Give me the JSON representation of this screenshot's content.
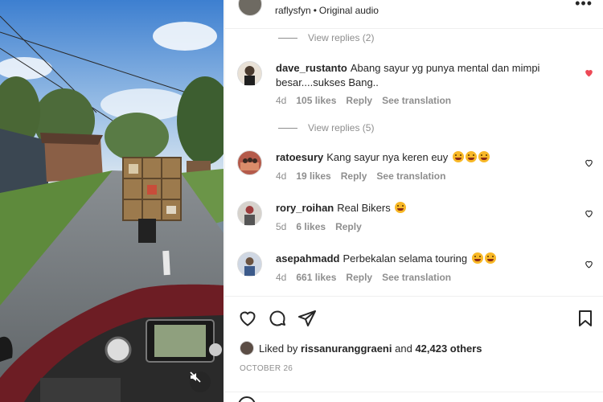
{
  "header": {
    "username": "raflysfyn",
    "separator": "•",
    "audio": "Original audio",
    "more_icon": "more-horizontal-icon"
  },
  "replies": [
    {
      "label": "View replies (2)"
    },
    {
      "label": "View replies (5)"
    }
  ],
  "comments": [
    {
      "username": "dave_rustanto",
      "text": "Abang sayur yg punya mental dan mimpi besar....sukses Bang..",
      "age": "4d",
      "likes": "105 likes",
      "reply": "Reply",
      "translate": "See translation",
      "liked": true
    },
    {
      "username": "ratoesury",
      "text": "Kang sayur nya keren euy",
      "age": "4d",
      "likes": "19 likes",
      "reply": "Reply",
      "translate": "See translation",
      "liked": false
    },
    {
      "username": "rory_roihan",
      "text": "Real Bikers",
      "age": "5d",
      "likes": "6 likes",
      "reply": "Reply",
      "translate": "",
      "liked": false
    },
    {
      "username": "asepahmadd",
      "text": "Perbekalan selama touring",
      "age": "4d",
      "likes": "661 likes",
      "reply": "Reply",
      "translate": "See translation",
      "liked": false
    }
  ],
  "actions": {
    "liked_prefix": "Liked by",
    "liked_user": "rissanuranggraeni",
    "liked_and": "and",
    "liked_count": "42,423 others",
    "date": "OCTOBER 26"
  },
  "colors": {
    "heart_liked": "#ed4956",
    "muted_text": "#8e8e8e",
    "primary_text": "#262626",
    "divider": "#efefef"
  }
}
